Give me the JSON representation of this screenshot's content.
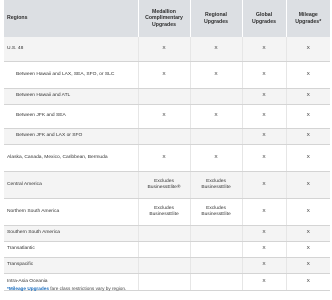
{
  "table": {
    "headers": [
      "Regions",
      "Medallion Complimentary Upgrades",
      "Regional Upgrades",
      "Global Upgrades",
      "Mileage Upgrades*"
    ],
    "rows": [
      {
        "region": "U.S. 48",
        "indent": false,
        "cells": [
          "X",
          "X",
          "X",
          "X"
        ]
      },
      {
        "region": "Between Hawaii and LAX, SEA, SFO, or SLC",
        "indent": true,
        "cells": [
          "X",
          "X",
          "X",
          "X"
        ]
      },
      {
        "region": "Between Hawaii and ATL",
        "indent": true,
        "cells": [
          "",
          "",
          "X",
          "X"
        ]
      },
      {
        "region": "Between JFK and SEA",
        "indent": true,
        "cells": [
          "X",
          "X",
          "X",
          "X"
        ]
      },
      {
        "region": "Between JFK and LAX or SFO",
        "indent": true,
        "cells": [
          "",
          "",
          "X",
          "X"
        ]
      },
      {
        "region": "Alaska, Canada, Mexico, Caribbean, Bermuda",
        "indent": false,
        "cells": [
          "X",
          "X",
          "X",
          "X"
        ]
      },
      {
        "region": "Central America",
        "indent": false,
        "cells": [
          "Excludes BusinessElite®",
          "Excludes BusinessElite",
          "X",
          "X"
        ]
      },
      {
        "region": "Northern South America",
        "indent": false,
        "cells": [
          "Excludes BusinessElite",
          "Excludes BusinessElite",
          "X",
          "X"
        ]
      },
      {
        "region": "Southern South America",
        "indent": false,
        "cells": [
          "",
          "",
          "X",
          "X"
        ]
      },
      {
        "region": "Transatlantic",
        "indent": false,
        "cells": [
          "",
          "",
          "X",
          "X"
        ]
      },
      {
        "region": "Transpacific",
        "indent": false,
        "cells": [
          "",
          "",
          "X",
          "X"
        ]
      },
      {
        "region": "Intra-Asia Oceania",
        "indent": false,
        "cells": [
          "",
          "",
          "X",
          "X"
        ]
      }
    ]
  },
  "footnote": {
    "marker": "*",
    "link_text": "Mileage Upgrades",
    "text": " fare class restrictions vary by region."
  }
}
